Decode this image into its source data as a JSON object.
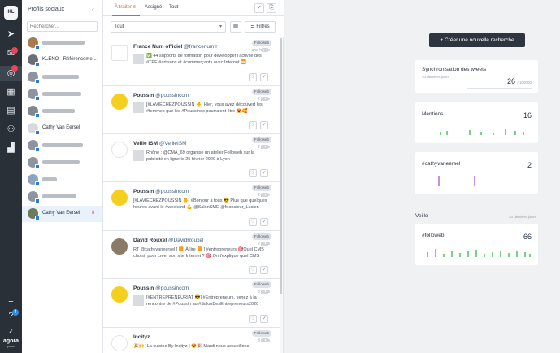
{
  "rail": {
    "logo": "KL",
    "brand": "agora",
    "brand_sub": "pulse",
    "help_badge": "4"
  },
  "profiles": {
    "title": "Profils sociaux",
    "search_placeholder": "Rechercher...",
    "items": [
      {
        "name": "",
        "style": "bar"
      },
      {
        "name": "KLENO - Référenceme...",
        "style": "text"
      },
      {
        "name": "",
        "style": "bar"
      },
      {
        "name": "",
        "style": "bar"
      },
      {
        "name": "",
        "style": "bar"
      },
      {
        "name": "Cathy Van Eersel",
        "style": "text"
      },
      {
        "name": "",
        "style": "bar"
      },
      {
        "name": "",
        "style": "bar"
      },
      {
        "name": "",
        "style": "bar"
      },
      {
        "name": "",
        "style": "bar"
      },
      {
        "name": "Cathy Van Eersel",
        "style": "text",
        "count": "8",
        "selected": true
      }
    ]
  },
  "feed": {
    "tabs": [
      {
        "label": "À traiter",
        "count": "8",
        "active": true
      },
      {
        "label": "Assigné"
      },
      {
        "label": "Tout"
      }
    ],
    "filter_select": "Tout",
    "filters_button": "Filtres",
    "posts": [
      {
        "name": "France Num officiel",
        "handle": "@francenumfr",
        "tag": "Followeb",
        "time": "une heure",
        "text": "✅ 44 supports de formation pour développer l'activité des #TPE #artisans et #commerçants avec Internet ⏩",
        "avatar": "francenum",
        "thumb": true
      },
      {
        "name": "Poussin",
        "handle": "@poussincom",
        "tag": "Followeb",
        "time": "2 jours",
        "text": "[#LAVIECHEZPOUSSIN 🐥] Hier, vous avez découvert les #femmes que les #Poussines pourraient être 😍🥰",
        "avatar": "poussin",
        "thumb": true
      },
      {
        "name": "Veille ISM",
        "handle": "@VeilleISM",
        "tag": "Followeb",
        "time": "2 jours",
        "text": "Rhône : @CMA_69 organise un atelier Followeb sur la publicité en ligne le 25 février 2020 à Lyon",
        "avatar": "ism",
        "thumb": true
      },
      {
        "name": "Poussin",
        "handle": "@poussincom",
        "tag": "Followeb",
        "time": "2 jours",
        "text": "[#LAVIECHEZPOUSSIN 🐥] #Bonjour à tous 😎 Plus que quelques heures avant le #weekend 💪 @SalonSME @Monsieur_Lucien",
        "avatar": "poussin",
        "thumb": false
      },
      {
        "name": "David Rouxel",
        "handle": "@DavidRouxel",
        "tag": "Followeb",
        "time": "2 jours",
        "text": "RT @cathyvaneersel [ 📙 À lire 📙 ] #entrepreneurs 🎯Quel CMS choisir pour créer son site Internet ? 🎯 On t'explique quel CMS",
        "avatar": "david",
        "thumb": false
      },
      {
        "name": "Poussin",
        "handle": "@poussincom",
        "tag": "Followeb",
        "time": "3 jours",
        "text": "[#ENTREPRENEURIAT 😎] #Entrepreneurs, venez à la rencontre de #Poussin au #SalonDesEntrepreneurs2020",
        "avatar": "poussin",
        "thumb": true
      },
      {
        "name": "Incityz",
        "handle": "",
        "tag": "Followeb",
        "time": "3 jours",
        "text": "🎉🙌[ La cuisine By Incityz ] 😍🎉 Mardi nous accueillons",
        "avatar": "incityz",
        "thumb": false
      }
    ]
  },
  "main": {
    "cta_label": "+ Créer une nouvelle recherche",
    "sync": {
      "title": "Synchronisation des tweets",
      "subtitle": "30 derniers jours",
      "value": "26",
      "max": "/ 100000"
    },
    "mentions": {
      "title": "Mentions",
      "value": "16"
    },
    "hashtag": {
      "title": "#cathyvaneersel",
      "value": "2"
    },
    "veille": {
      "title": "Veille",
      "subtitle": "30 derniers jours"
    },
    "followeb": {
      "title": "#followeb",
      "value": "66"
    },
    "colors": {
      "accent": "#e45b3d",
      "spark_green": "#7ccf8a",
      "spark_purple": "#c88fe0"
    }
  }
}
